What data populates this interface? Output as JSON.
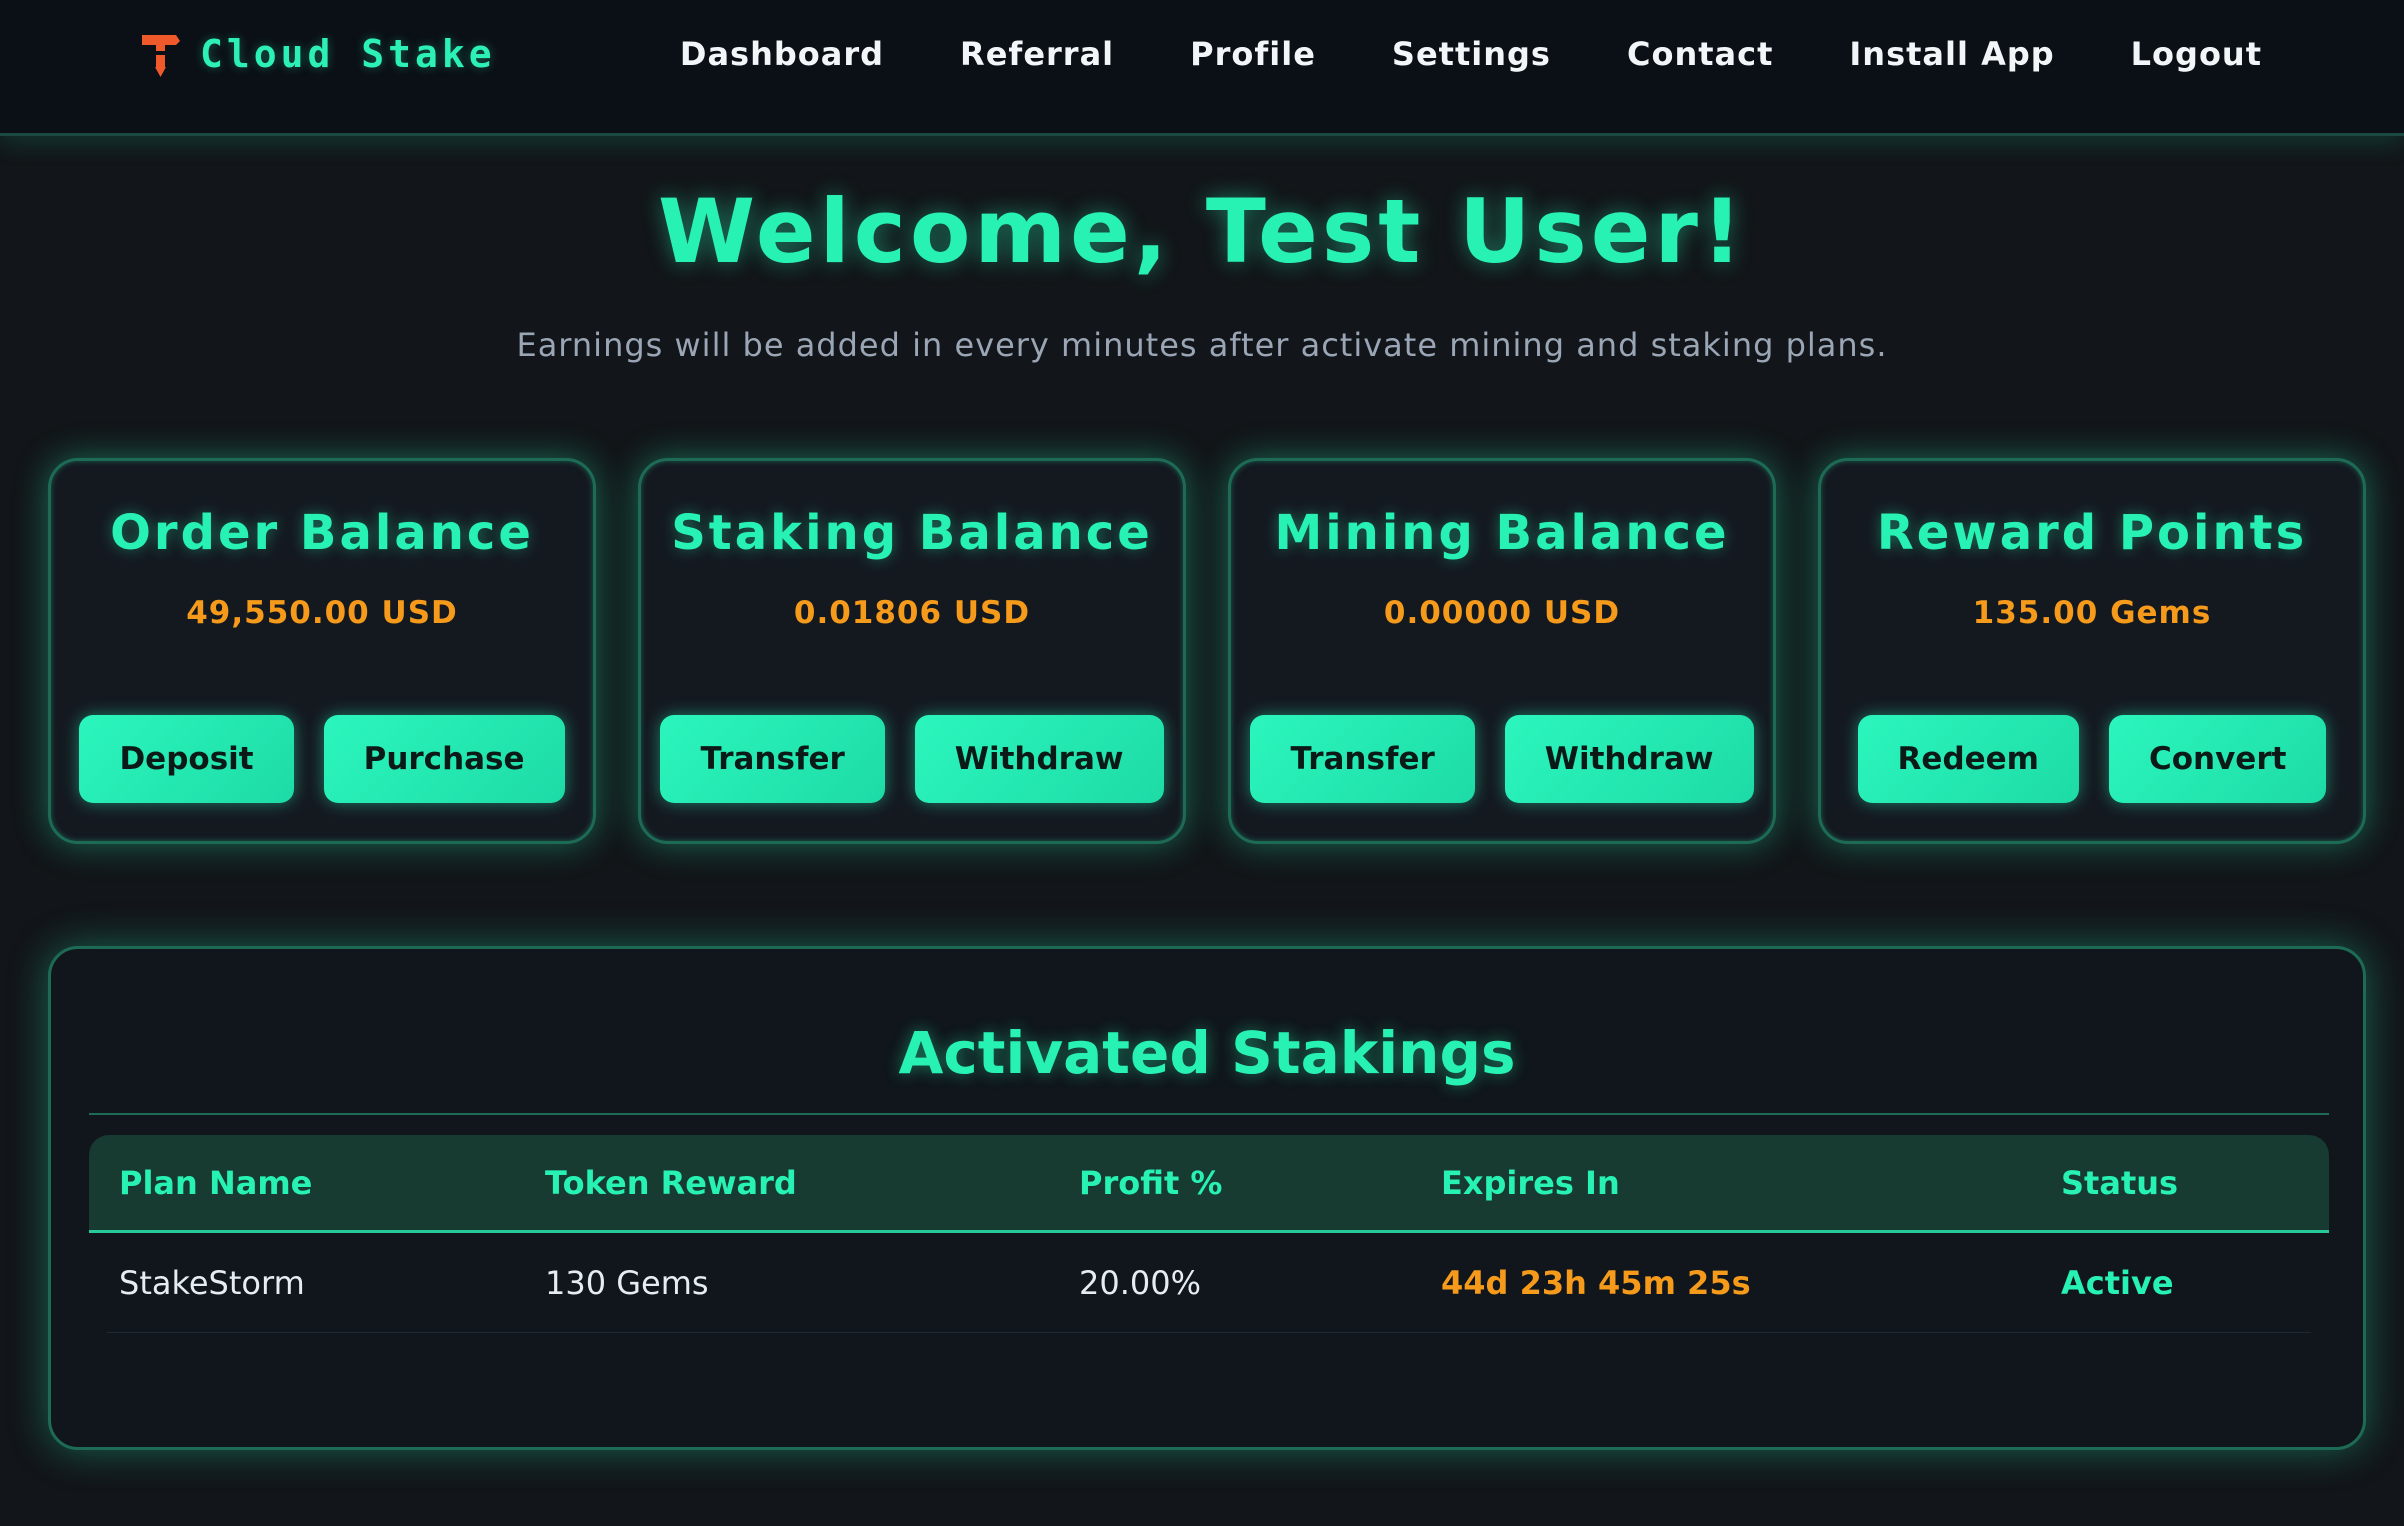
{
  "navbar": {
    "brand": "Cloud Stake",
    "brand_icon": "miner-hammer-icon",
    "links": [
      "Dashboard",
      "Referral",
      "Profile",
      "Settings",
      "Contact",
      "Install App",
      "Logout"
    ]
  },
  "hero": {
    "welcome": "Welcome, Test User!",
    "subtitle": "Earnings will be added in every minutes after activate mining and staking plans."
  },
  "cards": [
    {
      "title": "Order Balance",
      "value": "49,550.00 USD",
      "buttons": [
        "Deposit",
        "Purchase"
      ]
    },
    {
      "title": "Staking Balance",
      "value": "0.01806 USD",
      "buttons": [
        "Transfer",
        "Withdraw"
      ]
    },
    {
      "title": "Mining Balance",
      "value": "0.00000 USD",
      "buttons": [
        "Transfer",
        "Withdraw"
      ]
    },
    {
      "title": "Reward Points",
      "value": "135.00 Gems",
      "buttons": [
        "Redeem",
        "Convert"
      ]
    }
  ],
  "stakings": {
    "title": "Activated Stakings",
    "columns": [
      "Plan Name",
      "Token Reward",
      "Profit %",
      "Expires In",
      "Status"
    ],
    "rows": [
      {
        "plan": "StakeStorm",
        "reward": "130 Gems",
        "profit": "20.00%",
        "expires": "44d 23h 45m 25s",
        "status": "Active"
      }
    ]
  },
  "colors": {
    "accent": "#27f2b4",
    "value": "#f59a1a",
    "background": "#121519",
    "navbar": "#0b1016",
    "brand_icon": "#f0592a"
  }
}
